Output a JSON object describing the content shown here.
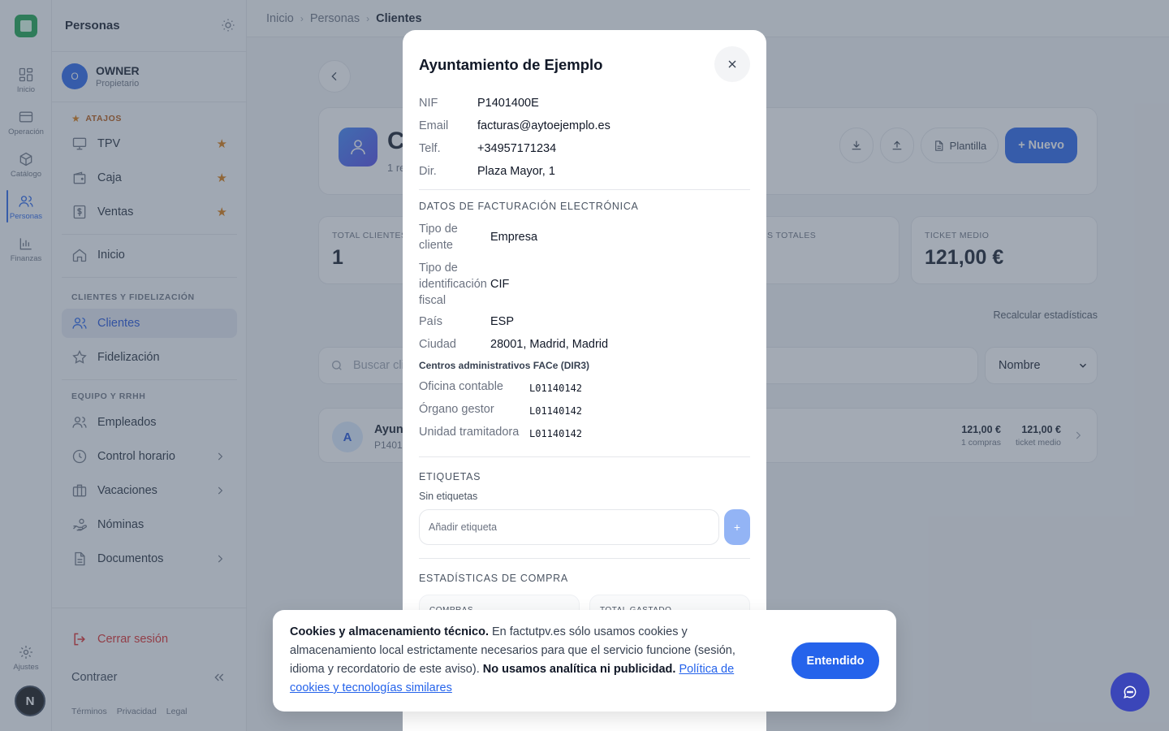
{
  "rail": {
    "items": [
      {
        "label": "Inicio",
        "icon": "grid-icon"
      },
      {
        "label": "Operación",
        "icon": "card-icon"
      },
      {
        "label": "Catálogo",
        "icon": "box-icon"
      },
      {
        "label": "Personas",
        "icon": "users-icon"
      },
      {
        "label": "Finanzas",
        "icon": "bar-chart-icon"
      }
    ],
    "settings_label": "Ajustes",
    "avatar_letter": "N"
  },
  "sidebar": {
    "title": "Personas",
    "user": {
      "initial": "O",
      "name": "OWNER",
      "role": "Propietario"
    },
    "shortcuts_label": "ATAJOS",
    "shortcuts": [
      {
        "label": "TPV"
      },
      {
        "label": "Caja"
      },
      {
        "label": "Ventas"
      }
    ],
    "home_label": "Inicio",
    "section_clients": "CLIENTES Y FIDELIZACIÓN",
    "clients_items": [
      {
        "label": "Clientes"
      },
      {
        "label": "Fidelización"
      }
    ],
    "section_team": "EQUIPO Y RRHH",
    "team_items": [
      {
        "label": "Empleados"
      },
      {
        "label": "Control horario"
      },
      {
        "label": "Vacaciones"
      },
      {
        "label": "Nóminas"
      },
      {
        "label": "Documentos"
      }
    ],
    "logout_label": "Cerrar sesión",
    "collapse_label": "Contraer",
    "footer_links": [
      "Términos",
      "Privacidad",
      "Legal"
    ]
  },
  "breadcrumb": [
    "Inicio",
    "Personas",
    "Clientes"
  ],
  "page": {
    "title_partial": "C",
    "subtitle_partial": "1 re",
    "plantilla_label": "Plantilla",
    "new_label": "+ Nuevo",
    "stats": [
      {
        "label": "TOTAL CLIENTES",
        "value": "1"
      },
      {
        "label": "S TOTALES",
        "value": ""
      },
      {
        "label": "TICKET MEDIO",
        "value": "121,00 €"
      }
    ],
    "recalc_label": "Recalcular estadísticas",
    "search_placeholder": "Buscar cli",
    "sort_value": "Nombre",
    "client": {
      "initial": "A",
      "name_partial": "Ayun",
      "nif_partial": "P1401",
      "total": "121,00 €",
      "total_caption": "1 compras",
      "ticket": "121,00 €",
      "ticket_caption": "ticket medio"
    }
  },
  "modal": {
    "title": "Ayuntamiento de Ejemplo",
    "basic": [
      {
        "key": "NIF",
        "value": "P1401400E"
      },
      {
        "key": "Email",
        "value": "facturas@aytoejemplo.es"
      },
      {
        "key": "Telf.",
        "value": "+34957171234"
      },
      {
        "key": "Dir.",
        "value": "Plaza Mayor, 1"
      }
    ],
    "einvoice_section": "DATOS DE FACTURACIÓN ELECTRÓNICA",
    "einvoice": [
      {
        "key1": "Tipo de",
        "key2": "cliente",
        "value": "Empresa"
      },
      {
        "key1": "Tipo de",
        "key2": "identificación",
        "key3": "fiscal",
        "value": "CIF"
      },
      {
        "key": "País",
        "value": "ESP"
      },
      {
        "key": "Ciudad",
        "value": "28001, Madrid, Madrid"
      }
    ],
    "face_subhead": "Centros administrativos FACe (DIR3)",
    "face": [
      {
        "key": "Oficina contable",
        "value": "L01140142"
      },
      {
        "key": "Órgano gestor",
        "value": "L01140142"
      },
      {
        "key": "Unidad tramitadora",
        "value": "L01140142"
      }
    ],
    "tags_section": "ETIQUETAS",
    "tags_empty": "Sin etiquetas",
    "tag_placeholder": "Añadir etiqueta",
    "tag_add": "+",
    "purchase_section": "ESTADÍSTICAS DE COMPRA",
    "purchase_stats": [
      {
        "label": "COMPRAS"
      },
      {
        "label": "TOTAL GASTADO"
      }
    ]
  },
  "cookie": {
    "bold1": "Cookies y almacenamiento técnico.",
    "text1": " En factutpv.es sólo usamos cookies y almacenamiento local estrictamente necesarios para que el servicio funcione (sesión, idioma y recordatorio de este aviso). ",
    "bold2": "No usamos analítica ni publicidad.",
    "link": "Política de cookies y tecnologías similares",
    "button": "Entendido"
  },
  "colors": {
    "accent": "#2563eb",
    "favorite": "#d97706",
    "logout": "#dc2626"
  }
}
